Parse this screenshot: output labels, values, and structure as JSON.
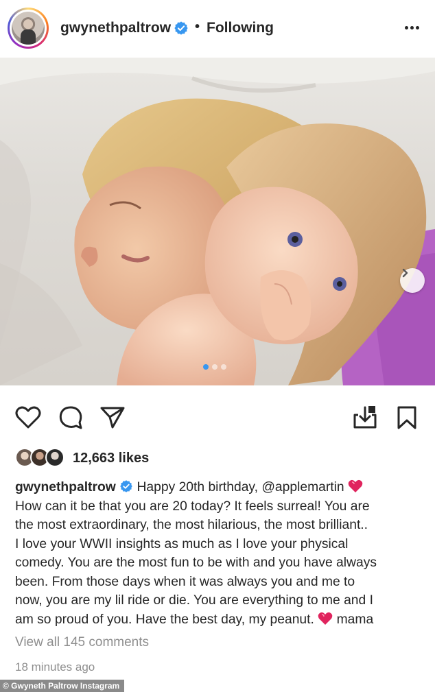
{
  "header": {
    "username": "gwynethpaltrow",
    "separator": "•",
    "follow_status": "Following",
    "more_icon": "more-horizontal-icon",
    "verified_icon": "verified-badge-icon",
    "verified_color": "#3897f0"
  },
  "post": {
    "carousel_total": 3,
    "carousel_current": 1,
    "next_icon": "chevron-right-icon"
  },
  "actions": {
    "like_icon": "heart-outline-icon",
    "comment_icon": "comment-bubble-icon",
    "share_icon": "paper-plane-icon",
    "download_icon": "download-icon",
    "save_icon": "bookmark-icon"
  },
  "likes": {
    "count_text": "12,663 likes"
  },
  "caption": {
    "username": "gwynethpaltrow",
    "lines": [
      "Happy 20th birthday, @applemartin",
      "How can it be that you are 20 today? It feels surreal! You are",
      "the most extraordinary, the most hilarious, the most brilliant..",
      "I love your WWII insights as much as I love your physical",
      "comedy. You are the most fun to be with and you have always",
      "been. From those days when it was always you and me to",
      "now, you are my lil ride or die. You are everything to me and I",
      "am so proud of you. Have the best day, my peanut.",
      "mama"
    ],
    "heart_emoji": "heart-emoji-icon"
  },
  "comments": {
    "view_all_text": "View all 145 comments"
  },
  "timestamp": "18 minutes ago",
  "credit": "© Gwyneth Paltrow Instagram"
}
